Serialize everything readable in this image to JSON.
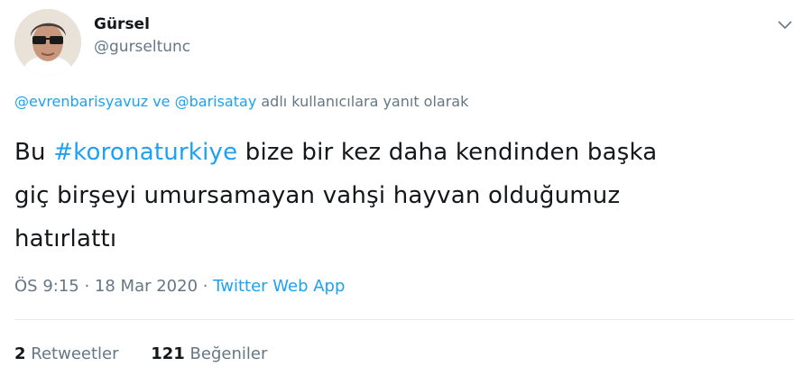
{
  "author": {
    "display_name": "Gürsel",
    "handle": "@gurseltunc"
  },
  "reply_context": {
    "mention_1": "@evrenbarisyavuz",
    "connector": " ve ",
    "mention_2": "@barisatay",
    "suffix": " adlı kullanıcılara yanıt olarak"
  },
  "tweet": {
    "prefix": "Bu ",
    "hashtag": "#koronaturkiye",
    "line1_rest": " bize bir kez daha kendinden başka",
    "line2": "giç birşeyi umursamayan vahşi hayvan olduğumuz",
    "line3": "hatırlattı"
  },
  "meta": {
    "time": "ÖS 9:15",
    "separator_1": " · ",
    "date": "18 Mar 2020",
    "separator_2": " · ",
    "source": "Twitter Web App"
  },
  "stats": {
    "retweets_count": "2",
    "retweets_label": "Retweetler",
    "likes_count": "121",
    "likes_label": "Beğeniler"
  },
  "icons": {
    "caret": "chevron-down-icon"
  },
  "colors": {
    "link": "#1da1f2",
    "secondary_text": "#657786",
    "primary_text": "#14171a",
    "divider": "#e6ecf0"
  }
}
